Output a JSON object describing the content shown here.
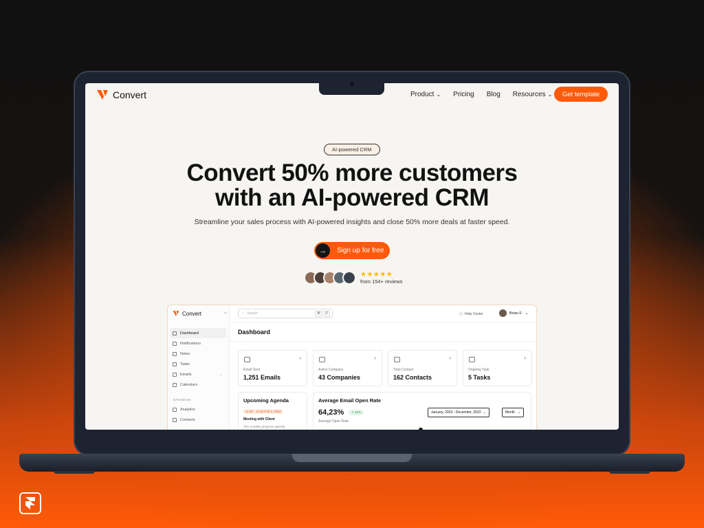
{
  "site": {
    "logo_text": "Convert",
    "nav": [
      {
        "label": "Product",
        "dropdown": true
      },
      {
        "label": "Pricing",
        "dropdown": false
      },
      {
        "label": "Blog",
        "dropdown": false
      },
      {
        "label": "Resources",
        "dropdown": true
      }
    ],
    "cta_label": "Get template"
  },
  "hero": {
    "badge": "AI-powered CRM",
    "title_line1": "Convert 50% more customers",
    "title_line2": "with an AI-powered CRM",
    "subtitle": "Streamline your sales process with AI-powered insights and close 50% more deals at faster speed.",
    "signup_label": "Sign up for free",
    "rating_stars": 5,
    "reviews_text": "from 154+ reviews",
    "avatar_colors": [
      "#8a6a55",
      "#4e4038",
      "#a8826a",
      "#5b6770",
      "#39424c"
    ]
  },
  "dashboard": {
    "logo_text": "Convert",
    "search_placeholder": "Search",
    "shortcut_keys": [
      "⌘",
      "F"
    ],
    "help_label": "Help Center",
    "user_name": "Brian F.",
    "title": "Dashboard",
    "menu": [
      {
        "label": "Dashboard",
        "icon": "dashboard-icon",
        "active": true
      },
      {
        "label": "Notifications",
        "icon": "bell-icon",
        "active": false
      },
      {
        "label": "Notes",
        "icon": "note-icon",
        "active": false
      },
      {
        "label": "Tasks",
        "icon": "task-icon",
        "active": false
      },
      {
        "label": "Emails",
        "icon": "mail-icon",
        "active": false,
        "expandable": true
      },
      {
        "label": "Calendars",
        "icon": "calendar-icon",
        "active": false
      }
    ],
    "database_label": "DATABASE",
    "database_menu": [
      {
        "label": "Analytics",
        "icon": "analytics-icon"
      },
      {
        "label": "Contacts",
        "icon": "contacts-icon"
      }
    ],
    "stats": [
      {
        "label": "Email Sent",
        "value": "1,251 Emails"
      },
      {
        "label": "Active Company",
        "value": "43 Companies"
      },
      {
        "label": "Total Contact",
        "value": "162 Contacts"
      },
      {
        "label": "Ongoing Task",
        "value": "5 Tasks"
      }
    ],
    "agenda": {
      "title": "Upcoming Agenda",
      "time_tag": "11:00 - 12:00 Feb 2, 2019",
      "meeting_title": "Meeting with Client",
      "meeting_desc": "This monthly progress agenda"
    },
    "rate": {
      "title": "Average Email Open Rate",
      "value": "64,23%",
      "change": "12%",
      "label": "Average Open Rate",
      "date_range": "January, 2023 - December, 2023",
      "period": "Month"
    }
  },
  "colors": {
    "accent": "#ff5a0a",
    "dark": "#121212"
  }
}
